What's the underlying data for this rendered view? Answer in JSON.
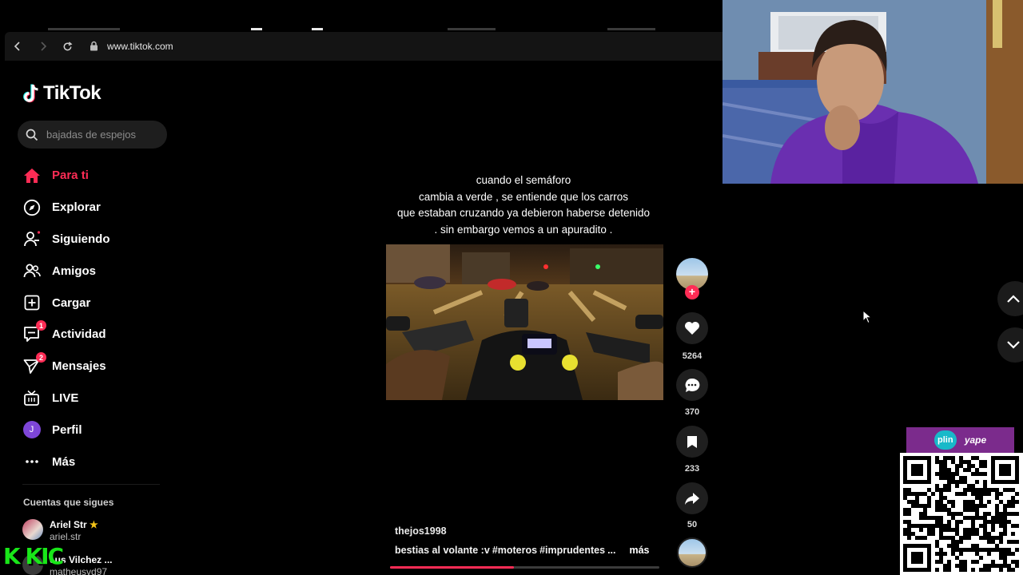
{
  "browser": {
    "url": "www.tiktok.com"
  },
  "sidebar": {
    "logo": "TikTok",
    "search_placeholder": "bajadas de espejos",
    "nav": [
      {
        "label": "Para ti",
        "icon": "home-icon",
        "active": true
      },
      {
        "label": "Explorar",
        "icon": "compass-icon"
      },
      {
        "label": "Siguiendo",
        "icon": "following-icon"
      },
      {
        "label": "Amigos",
        "icon": "friends-icon"
      },
      {
        "label": "Cargar",
        "icon": "upload-icon"
      },
      {
        "label": "Actividad",
        "icon": "activity-icon",
        "badge": "1"
      },
      {
        "label": "Mensajes",
        "icon": "messages-icon",
        "badge": "2"
      },
      {
        "label": "LIVE",
        "icon": "live-icon"
      },
      {
        "label": "Perfil",
        "icon": "profile-avatar",
        "avatar_letter": "J"
      },
      {
        "label": "Más",
        "icon": "more-icon"
      }
    ],
    "following_title": "Cuentas que sigues",
    "accounts": [
      {
        "name": "Ariel Str",
        "handle": "ariel.str",
        "star": "★"
      },
      {
        "name": "eus Vilchez ...",
        "handle": "matheusvd97"
      }
    ],
    "overlay_text": "K KIC"
  },
  "video": {
    "caption_lines": [
      "cuando el semáforo",
      "cambia a  verde , se entiende que los carros",
      "que estaban cruzando ya debieron haberse detenido",
      ". sin embargo vemos  a un apuradito ."
    ],
    "author": "thejos1998",
    "description": [
      "bestias al volante :v",
      "#moteros",
      "#imprudentes",
      "..."
    ],
    "more_label": "más",
    "progress": 0.46
  },
  "actions": {
    "likes": "5264",
    "comments": "370",
    "saves": "233",
    "shares": "50",
    "follow_symbol": "+"
  },
  "payment": {
    "plin": "plin",
    "yape": "yape"
  },
  "colors": {
    "accent": "#fe2c55",
    "background": "#000000",
    "overlay_green": "#19e619",
    "pay_banner": "#7b2b8c"
  }
}
